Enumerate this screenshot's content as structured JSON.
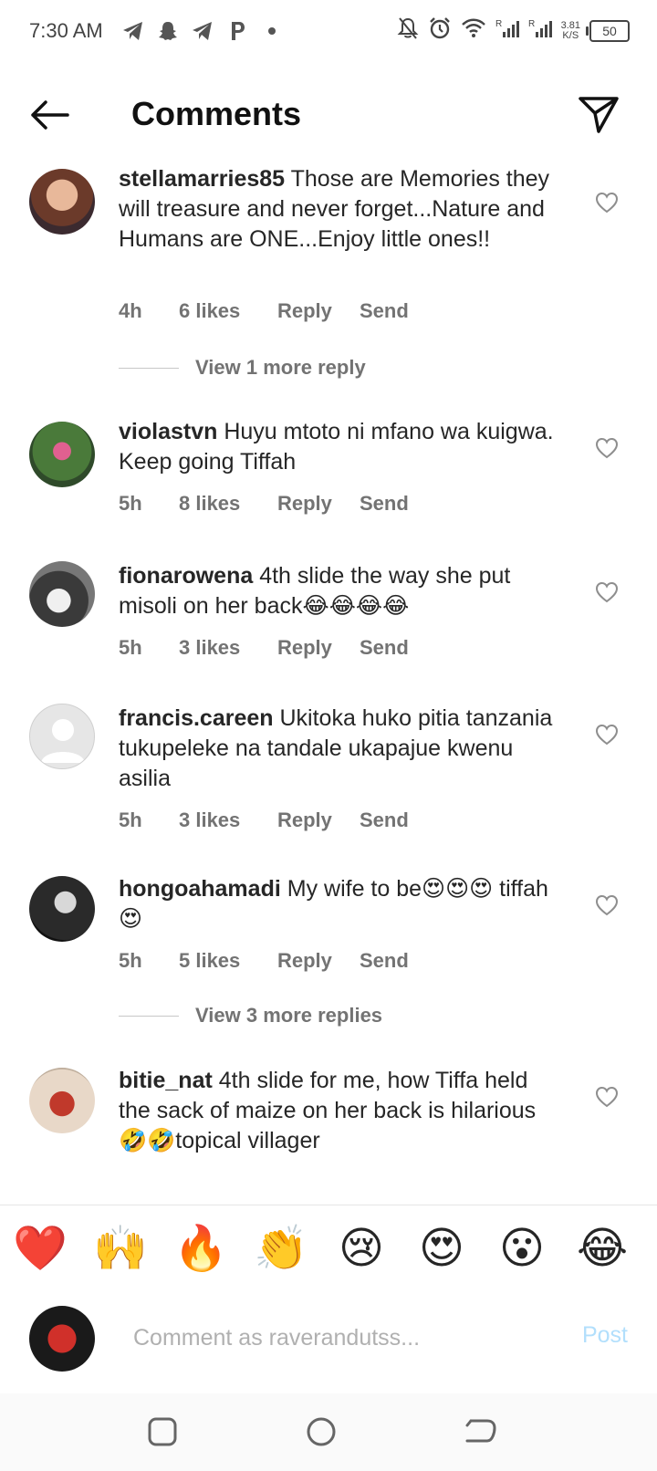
{
  "status_bar": {
    "time": "7:30 AM",
    "speed_value": "3.81",
    "speed_unit": "K/S",
    "battery": "50",
    "left_icons": [
      "telegram-icon",
      "snapchat-icon",
      "telegram-icon",
      "pinterest-icon",
      "dot-icon"
    ],
    "right_icons": [
      "bell-off-icon",
      "alarm-icon",
      "wifi-icon",
      "signal-icon",
      "signal-icon"
    ]
  },
  "header": {
    "title": "Comments",
    "back_icon": "arrow-left-icon",
    "share_icon": "send-icon"
  },
  "comments": [
    {
      "username": "stellamarries85",
      "text": " Those are Memories they will treasure and never forget...Nature and Humans are ONE...Enjoy little ones!!",
      "time": "4h",
      "likes": "6 likes",
      "reply": "Reply",
      "send": "Send"
    },
    {
      "username": "violastvn",
      "text": " Huyu mtoto ni mfano wa kuigwa. Keep going Tiffah",
      "time": "5h",
      "likes": "8 likes",
      "reply": "Reply",
      "send": "Send"
    },
    {
      "username": "fionarowena",
      "text": " 4th slide the way she put misoli on her back😂😂😂😂",
      "time": "5h",
      "likes": "3 likes",
      "reply": "Reply",
      "send": "Send"
    },
    {
      "username": "francis.careen",
      "text": " Ukitoka huko pitia tanzania tukupeleke na tandale ukapajue kwenu asilia",
      "time": "5h",
      "likes": "3 likes",
      "reply": "Reply",
      "send": "Send"
    },
    {
      "username": "hongoahamadi",
      "text": " My wife to be😍😍😍 tiffah😍",
      "time": "5h",
      "likes": "5 likes",
      "reply": "Reply",
      "send": "Send"
    },
    {
      "username": "bitie_nat",
      "text": " 4th slide for me, how Tiffa held the sack of maize on her back is hilarious 🤣🤣topical villager"
    }
  ],
  "view_more": [
    "View 1 more reply",
    "View 3 more replies"
  ],
  "emoji_bar": [
    "❤️",
    "🙌",
    "🔥",
    "👏",
    "😢",
    "😍",
    "😮",
    "😂"
  ],
  "input": {
    "placeholder": "Comment as raverandutss...",
    "post_label": "Post"
  },
  "nav_bar": [
    "square-icon",
    "circle-icon",
    "back-arrow-icon"
  ],
  "colors": {
    "post_disabled": "#b2dffc",
    "meta_gray": "#737373",
    "text": "#262626"
  }
}
